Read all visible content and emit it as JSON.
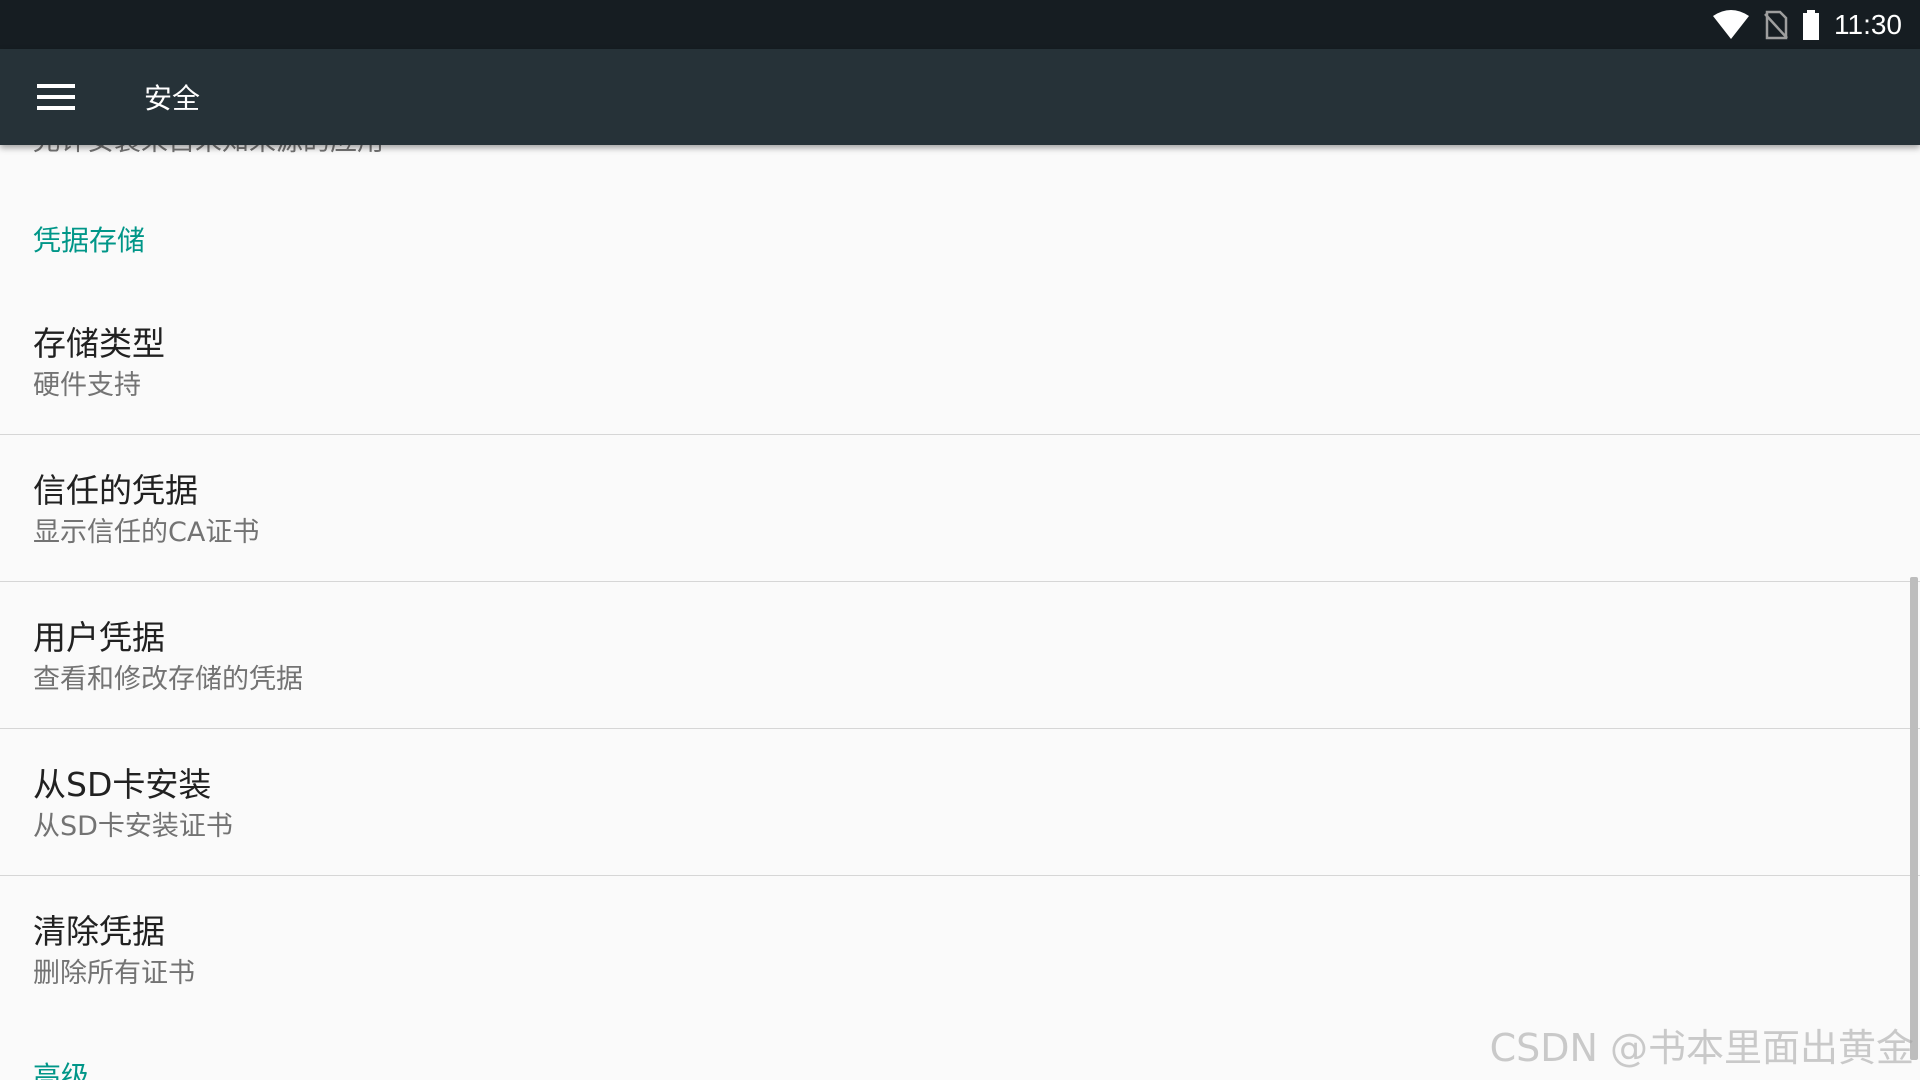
{
  "status_bar": {
    "time": "11:30",
    "icons": [
      "wifi-icon",
      "no-sim-icon",
      "battery-icon"
    ]
  },
  "app_bar": {
    "menu_icon": "hamburger-menu-icon",
    "title": "安全"
  },
  "clipped_summary": "允许安装来自未知来源的应用",
  "sections": {
    "credential_storage": {
      "header": "凭据存储",
      "items": [
        {
          "title": "存储类型",
          "summary": "硬件支持"
        },
        {
          "title": "信任的凭据",
          "summary": "显示信任的CA证书"
        },
        {
          "title": "用户凭据",
          "summary": "查看和修改存储的凭据"
        },
        {
          "title": "从SD卡安装",
          "summary": "从SD卡安装证书"
        },
        {
          "title": "清除凭据",
          "summary": "删除所有证书"
        }
      ]
    },
    "advanced": {
      "header": "高级"
    }
  },
  "watermark": "CSDN @书本里面出黄金",
  "colors": {
    "status_bar": "#161d22",
    "app_bar": "#263238",
    "accent": "#009688",
    "background": "#fafafa"
  }
}
